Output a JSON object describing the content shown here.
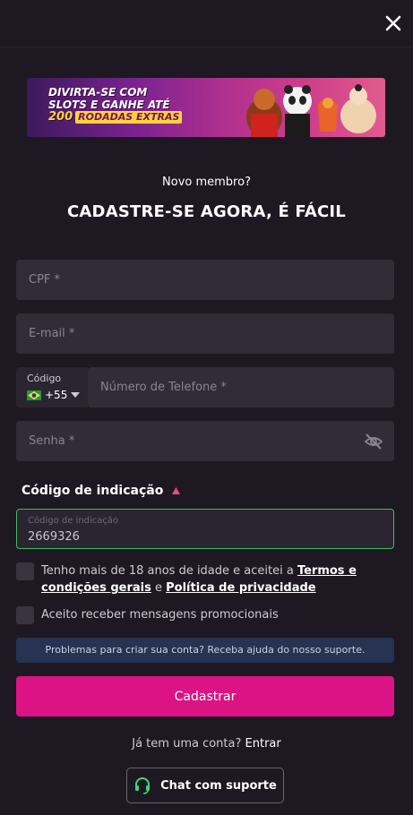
{
  "header": {
    "close_icon": "close-icon"
  },
  "banner": {
    "line1": "DIVIRTA-SE COM",
    "line2": "SLOTS E GANHE ATÉ",
    "number": "200",
    "highlight": "RODADAS EXTRAS"
  },
  "intro": {
    "subtitle": "Novo membro?",
    "title": "CADASTRE-SE AGORA, É FÁCIL"
  },
  "form": {
    "cpf_placeholder": "CPF *",
    "email_placeholder": "E-mail *",
    "country_label": "Código",
    "country_code": "+55",
    "phone_placeholder": "Número de Telefone *",
    "password_placeholder": "Senha *",
    "referral_toggle": "Código de indicação",
    "referral_label": "Código de indicação",
    "referral_value": "2669326",
    "terms_text": "Tenho mais de 18 anos de idade e aceitei a ",
    "terms_link": "Termos e condições gerais",
    "terms_and": " e ",
    "privacy_link": "Política de privacidade",
    "promo_text": "Aceito receber mensagens promocionais",
    "help_text": "Problemas para criar sua conta? Receba ajuda do nosso suporte.",
    "submit_label": "Cadastrar"
  },
  "footer": {
    "login_prompt": "Já tem uma conta? ",
    "login_link": "Entrar",
    "chat_label": "Chat com suporte"
  },
  "colors": {
    "background": "#1d1822",
    "field": "#322c38",
    "accent": "#dc1384",
    "success_border": "#3dbd5c",
    "help_bg": "#263352"
  }
}
